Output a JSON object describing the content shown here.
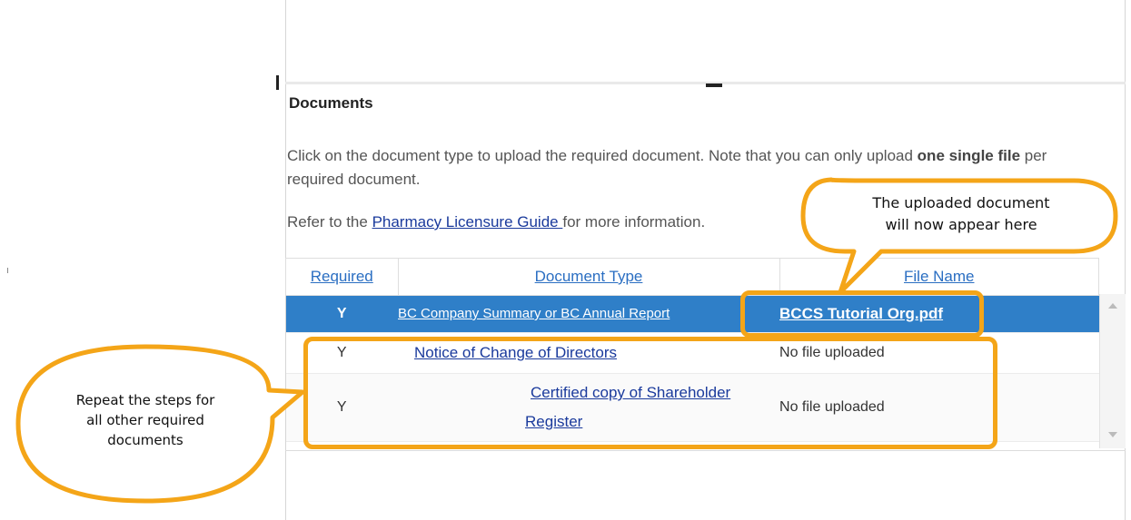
{
  "section": {
    "title": "Documents",
    "description_pre": "Click on the document type to upload the required document. Note that you can only upload ",
    "description_bold": "one single file",
    "description_post": " per required document.",
    "refer_pre": "Refer to the ",
    "refer_link": "Pharmacy Licensure Guide ",
    "refer_post": "for more information."
  },
  "table": {
    "headers": {
      "required": "Required",
      "document_type": "Document Type",
      "file_name": "File Name"
    },
    "rows": [
      {
        "required": "Y",
        "document_type": "BC Company Summary or BC Annual Report",
        "file_name": "BCCS Tutorial Org.pdf"
      },
      {
        "required": "Y",
        "document_type": "Notice of Change of Directors",
        "file_name": "No file uploaded"
      },
      {
        "required": "Y",
        "document_type": "Certified copy of Shareholder Register",
        "file_name": "No file uploaded"
      }
    ]
  },
  "callouts": {
    "uploaded_line1": "The uploaded document",
    "uploaded_line2": "will now appear here",
    "repeat_line1": "Repeat the steps for",
    "repeat_line2": "all other required",
    "repeat_line3": "documents"
  },
  "colors": {
    "accent": "#f4a518",
    "selected_row": "#2f7fc8",
    "link": "#1a3a9c"
  }
}
